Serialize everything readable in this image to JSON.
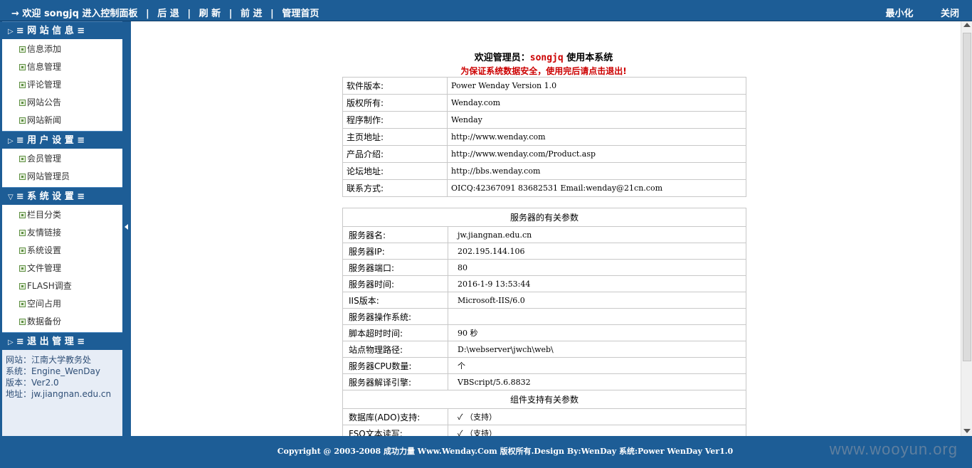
{
  "topbar": {
    "welcome": "→ 欢迎 songjq 进入控制面板",
    "back": "后 退",
    "refresh": "刷 新",
    "forward": "前 进",
    "home": "管理首页",
    "minimize": "最小化",
    "close": "关闭"
  },
  "sidebar": {
    "sections": [
      {
        "title": "≡ 网 站 信 息 ≡",
        "items": [
          "信息添加",
          "信息管理",
          "评论管理",
          "网站公告",
          "网站新闻"
        ]
      },
      {
        "title": "≡ 用 户 设 置 ≡",
        "items": [
          "会员管理",
          "网站管理员"
        ]
      },
      {
        "title": "≡ 系 统 设 置 ≡",
        "items": [
          "栏目分类",
          "友情链接",
          "系统设置",
          "文件管理",
          "FLASH调查",
          "空间占用",
          "数据备份"
        ]
      },
      {
        "title": "≡ 退 出 管 理 ≡",
        "items": []
      }
    ],
    "site_info": {
      "site": "网站：江南大学教务处",
      "system": "系统：Engine_WenDay",
      "version": "版本：Ver2.0",
      "address": "地址：jw.jiangnan.edu.cn"
    }
  },
  "main": {
    "welcome_prefix": "欢迎管理员：",
    "welcome_user": "songjq",
    "welcome_suffix": " 使用本系统",
    "warning": "为保证系统数据安全，使用完后请点击退出!",
    "software_rows": [
      {
        "k": "软件版本:",
        "v": "Power Wenday Version 1.0"
      },
      {
        "k": "版权所有:",
        "v": "Wenday.com"
      },
      {
        "k": "程序制作:",
        "v": "Wenday"
      },
      {
        "k": "主页地址:",
        "v": "http://www.wenday.com"
      },
      {
        "k": "产品介绍:",
        "v": "http://www.wenday.com/Product.asp"
      },
      {
        "k": "论坛地址:",
        "v": "http://bbs.wenday.com"
      },
      {
        "k": "联系方式:",
        "v": "OICQ:42367091 83682531 Email:wenday@21cn.com"
      }
    ],
    "server_header": "服务器的有关参数",
    "server_rows": [
      {
        "k": "服务器名:",
        "v": "jw.jiangnan.edu.cn"
      },
      {
        "k": "服务器IP:",
        "v": "202.195.144.106"
      },
      {
        "k": "服务器端口:",
        "v": "80"
      },
      {
        "k": "服务器时间:",
        "v": "2016-1-9 13:53:44"
      },
      {
        "k": "IIS版本:",
        "v": "Microsoft-IIS/6.0"
      },
      {
        "k": "服务器操作系统:",
        "v": ""
      },
      {
        "k": "脚本超时时间:",
        "v": "90 秒"
      },
      {
        "k": "站点物理路径:",
        "v": "D:\\webserver\\jwch\\web\\"
      },
      {
        "k": "服务器CPU数量:",
        "v": "个"
      },
      {
        "k": "服务器解译引擎:",
        "v": "VBScript/5.6.8832"
      }
    ],
    "component_header": "组件支持有关参数",
    "component_rows": [
      {
        "k": "数据库(ADO)支持:",
        "v": "✓ （支持）"
      },
      {
        "k": "FSO文本读写:",
        "v": "✓ （支持）"
      }
    ]
  },
  "footer": {
    "copyright": "Copyright @ 2003-2008 成功力量 Www.Wenday.Com 版权所有.Design By:WenDay 系统:Power WenDay Ver1.0",
    "watermark": "www.wooyun.org"
  },
  "colors": {
    "bar": "#1d5d96",
    "warning": "#cc0000"
  }
}
